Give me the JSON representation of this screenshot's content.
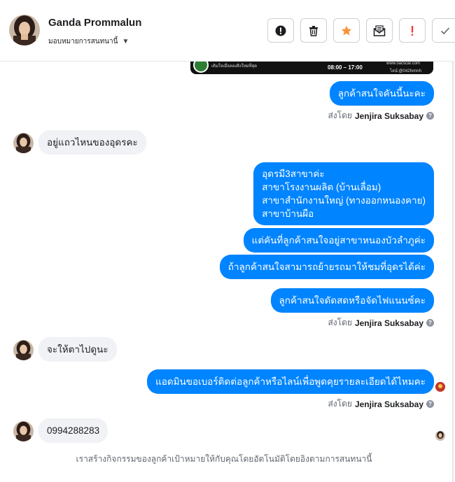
{
  "header": {
    "contact_name": "Ganda Prommalun",
    "assign_label": "มอบหมายการสนทนานี้",
    "toolbar": [
      {
        "icon": "alert-circle-icon"
      },
      {
        "icon": "trash-icon"
      },
      {
        "icon": "star-icon",
        "color": "#f7923b"
      },
      {
        "icon": "mail-icon"
      },
      {
        "icon": "exclamation-icon",
        "color": "#fa383e"
      },
      {
        "icon": "check-icon"
      }
    ]
  },
  "image_preview": {
    "brand": "เติมใจเมื่อลองสิ่งใหม่ที่สุด",
    "hours": "08:00 – 17:00",
    "site": "www.oacscar.com",
    "line": "ไลน์:@042fvmnh"
  },
  "messages": [
    {
      "dir": "out",
      "text": "ลูกค้าสนใจคันนี้นะคะ"
    },
    {
      "dir": "in",
      "text": "อยู่แถวไหนของอุดรคะ"
    },
    {
      "dir": "out",
      "lines": [
        "อุดรมี3สาขาค่ะ",
        "สาขาโรงงานผลิต (บ้านเลื่อม)",
        "สาขาสำนักงานใหญ่ (ทางออกหนองคาย)",
        "สาขาบ้านผือ"
      ]
    },
    {
      "dir": "out",
      "text": "แต่คันที่ลูกค้าสนใจอยู่สาขาหนองบัวลำภูค่ะ"
    },
    {
      "dir": "out",
      "text": "ถ้าลูกค้าสนใจสามารถย้ายรถมาให้ชมที่อุดรได้ค่ะ"
    },
    {
      "dir": "out",
      "text": "ลูกค้าสนใจดัดสดหรือจัดไฟแนนซ์คะ"
    },
    {
      "dir": "in",
      "text": "จะให้ตาไปดูนะ"
    },
    {
      "dir": "out",
      "text": "แอดมินขอเบอร์ติดต่อลูกค้าหรือไลน์เพื่อพูดคุยรายละเอียดได้ไหมคะ"
    },
    {
      "dir": "in",
      "text": "0994288283"
    }
  ],
  "sent_by": {
    "prefix": "ส่งโดย",
    "agent": "Jenjira Suksabay"
  },
  "footer_note": "เราสร้างกิจกรรมของลูกค้าเป้าหมายให้กับคุณโดยอัตโนมัติโดยอิงตามการสนทนานี้"
}
